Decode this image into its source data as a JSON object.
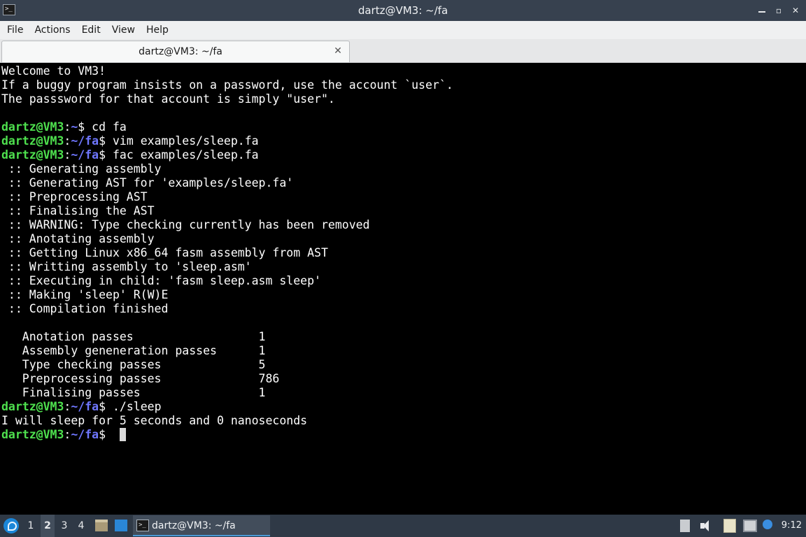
{
  "window": {
    "title": "dartz@VM3: ~/fa",
    "app_icon": "terminal-icon",
    "buttons": {
      "minimize": "minimize-icon",
      "restore": "restore-icon",
      "close": "close-icon"
    }
  },
  "menubar": {
    "items": [
      "File",
      "Actions",
      "Edit",
      "View",
      "Help"
    ]
  },
  "tab": {
    "label": "dartz@VM3: ~/fa",
    "close_icon": "close-icon"
  },
  "terminal": {
    "colors": {
      "user": "#4ee04e",
      "path": "#6f77ff",
      "text": "#ffffff",
      "background": "#000000"
    },
    "lines": [
      {
        "type": "text",
        "text": "Welcome to VM3!"
      },
      {
        "type": "text",
        "text": "If a buggy program insists on a password, use the account `user`."
      },
      {
        "type": "text",
        "text": "The passsword for that account is simply \"user\"."
      },
      {
        "type": "text",
        "text": ""
      },
      {
        "type": "prompt",
        "user": "dartz@VM3",
        "path": "~",
        "cmd": " cd fa"
      },
      {
        "type": "prompt",
        "user": "dartz@VM3",
        "path": "~/fa",
        "cmd": " vim examples/sleep.fa"
      },
      {
        "type": "prompt",
        "user": "dartz@VM3",
        "path": "~/fa",
        "cmd": " fac examples/sleep.fa"
      },
      {
        "type": "text",
        "text": " :: Generating assembly"
      },
      {
        "type": "text",
        "text": " :: Generating AST for 'examples/sleep.fa'"
      },
      {
        "type": "text",
        "text": " :: Preprocessing AST"
      },
      {
        "type": "text",
        "text": " :: Finalising the AST"
      },
      {
        "type": "text",
        "text": " :: WARNING: Type checking currently has been removed"
      },
      {
        "type": "text",
        "text": " :: Anotating assembly"
      },
      {
        "type": "text",
        "text": " :: Getting Linux x86_64 fasm assembly from AST"
      },
      {
        "type": "text",
        "text": " :: Writting assembly to 'sleep.asm'"
      },
      {
        "type": "text",
        "text": " :: Executing in child: 'fasm sleep.asm sleep'"
      },
      {
        "type": "text",
        "text": " :: Making 'sleep' R(W)E"
      },
      {
        "type": "text",
        "text": " :: Compilation finished"
      },
      {
        "type": "text",
        "text": ""
      },
      {
        "type": "text",
        "text": "   Anotation passes                  1"
      },
      {
        "type": "text",
        "text": "   Assembly geneneration passes      1"
      },
      {
        "type": "text",
        "text": "   Type checking passes              5"
      },
      {
        "type": "text",
        "text": "   Preprocessing passes              786"
      },
      {
        "type": "text",
        "text": "   Finalising passes                 1"
      },
      {
        "type": "prompt",
        "user": "dartz@VM3",
        "path": "~/fa",
        "cmd": " ./sleep"
      },
      {
        "type": "text",
        "text": "I will sleep for 5 seconds and 0 nanoseconds"
      },
      {
        "type": "prompt",
        "user": "dartz@VM3",
        "path": "~/fa",
        "cmd": " ",
        "cursor": true
      }
    ]
  },
  "taskbar": {
    "start_icon": "lxqt-menu-icon",
    "workspaces": [
      "1",
      "2",
      "3",
      "4"
    ],
    "active_workspace": "2",
    "quicklaunch": [
      "file-manager-icon",
      "show-desktop-icon"
    ],
    "task": {
      "icon": "terminal-icon",
      "label": "dartz@VM3: ~/fa"
    },
    "tray": [
      "document-icon",
      "volume-icon",
      "clipboard-icon",
      "network-icon",
      "update-icon"
    ],
    "clock": "9:12"
  }
}
